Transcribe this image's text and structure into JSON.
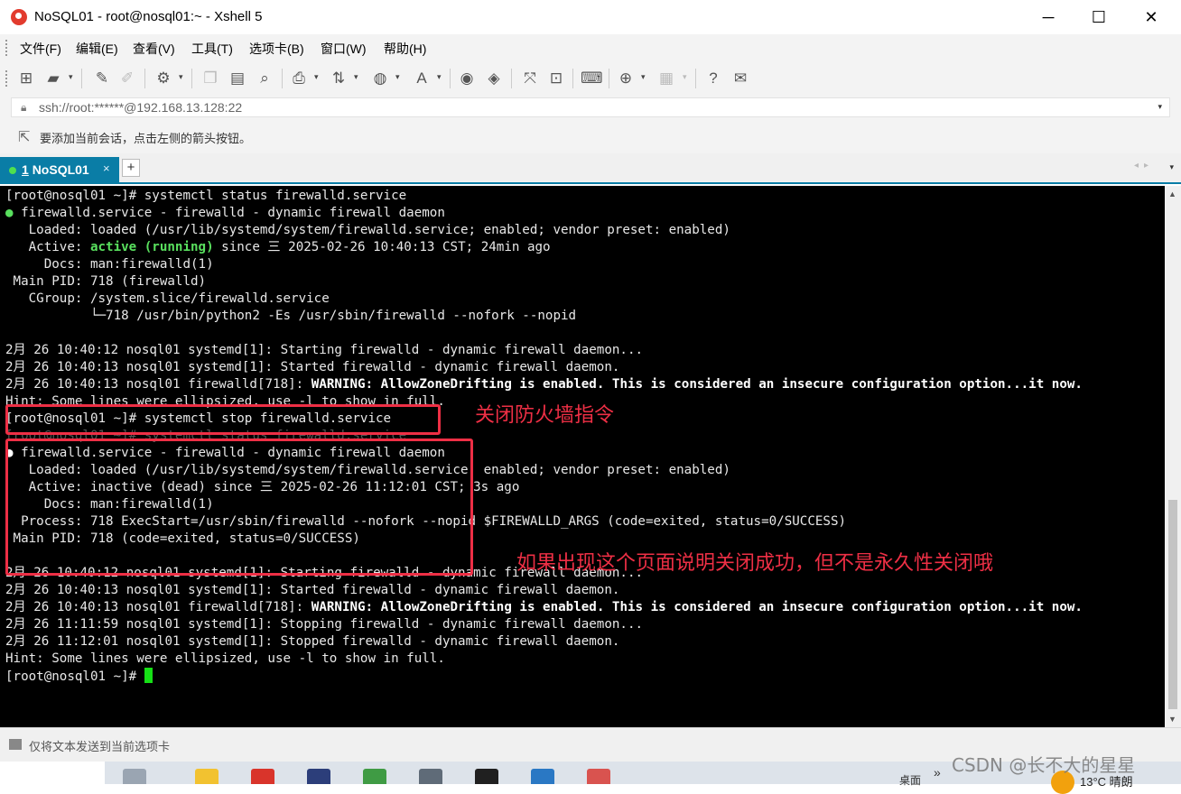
{
  "window": {
    "title": "NoSQL01 - root@nosql01:~ - Xshell 5",
    "minimize": "─",
    "maximize": "☐",
    "close": "✕"
  },
  "menu": [
    "文件(F)",
    "编辑(E)",
    "查看(V)",
    "工具(T)",
    "选项卡(B)",
    "窗口(W)",
    "帮助(H)"
  ],
  "address": {
    "value": "ssh://root:******@192.168.13.128:22"
  },
  "hint": {
    "text": "要添加当前会话，点击左侧的箭头按钮。"
  },
  "tab": {
    "number": "1",
    "label": "NoSQL01",
    "close": "×",
    "add": "+"
  },
  "terminal": {
    "l1": "[root@nosql01 ~]# systemctl status firewalld.service",
    "l2_dot": "●",
    "l2": " firewalld.service - firewalld - dynamic firewall daemon",
    "l3": "   Loaded: loaded (/usr/lib/systemd/system/firewalld.service; enabled; vendor preset: enabled)",
    "l4_a": "   Active: ",
    "l4_b": "active (running)",
    "l4_c": " since 三 2025-02-26 10:40:13 CST; 24min ago",
    "l5": "     Docs: man:firewalld(1)",
    "l6": " Main PID: 718 (firewalld)",
    "l7": "   CGroup: /system.slice/firewalld.service",
    "l8": "           └─718 /usr/bin/python2 -Es /usr/sbin/firewalld --nofork --nopid",
    "l9": "",
    "l10": "2月 26 10:40:12 nosql01 systemd[1]: Starting firewalld - dynamic firewall daemon...",
    "l11": "2月 26 10:40:13 nosql01 systemd[1]: Started firewalld - dynamic firewall daemon.",
    "l12_a": "2月 26 10:40:13 nosql01 firewalld[718]: ",
    "l12_b": "WARNING: AllowZoneDrifting is enabled. This is considered an insecure configuration option...it now.",
    "l13": "Hint: Some lines were ellipsized, use -l to show in full.",
    "l14": "[root@nosql01 ~]# systemctl stop firewalld.service",
    "l15": "[root@nosql01 ~]# systemctl status firewalld.service",
    "l16_dot": "●",
    "l16": " firewalld.service - firewalld - dynamic firewall daemon",
    "l17": "   Loaded: loaded (/usr/lib/systemd/system/firewalld.service; enabled; vendor preset: enabled)",
    "l18": "   Active: inactive (dead) since 三 2025-02-26 11:12:01 CST; 3s ago",
    "l19": "     Docs: man:firewalld(1)",
    "l20": "  Process: 718 ExecStart=/usr/sbin/firewalld --nofork --nopid $FIREWALLD_ARGS (code=exited, status=0/SUCCESS)",
    "l21": " Main PID: 718 (code=exited, status=0/SUCCESS)",
    "l22": "",
    "l23": "2月 26 10:40:12 nosql01 systemd[1]: Starting firewalld - dynamic firewall daemon...",
    "l24": "2月 26 10:40:13 nosql01 systemd[1]: Started firewalld - dynamic firewall daemon.",
    "l25_a": "2月 26 10:40:13 nosql01 firewalld[718]: ",
    "l25_b": "WARNING: AllowZoneDrifting is enabled. This is considered an insecure configuration option...it now.",
    "l26": "2月 26 11:11:59 nosql01 systemd[1]: Stopping firewalld - dynamic firewall daemon...",
    "l27": "2月 26 11:12:01 nosql01 systemd[1]: Stopped firewalld - dynamic firewall daemon.",
    "l28": "Hint: Some lines were ellipsized, use -l to show in full.",
    "l29": "[root@nosql01 ~]# "
  },
  "annotations": {
    "stop_command": "关闭防火墙指令",
    "result_note": "如果出现这个页面说明关闭成功，但不是永久性关闭哦"
  },
  "statusbar": {
    "text": "仅将文本发送到当前选项卡"
  },
  "taskbar": {
    "desktop": "桌面",
    "temperature": "13°C 晴朗"
  },
  "watermark": "CSDN @长不大的星星",
  "colors": {
    "accent": "#0a7da6",
    "annotation": "#ee2f45",
    "terminal_bg": "#000000",
    "active_green": "#59e05e"
  }
}
